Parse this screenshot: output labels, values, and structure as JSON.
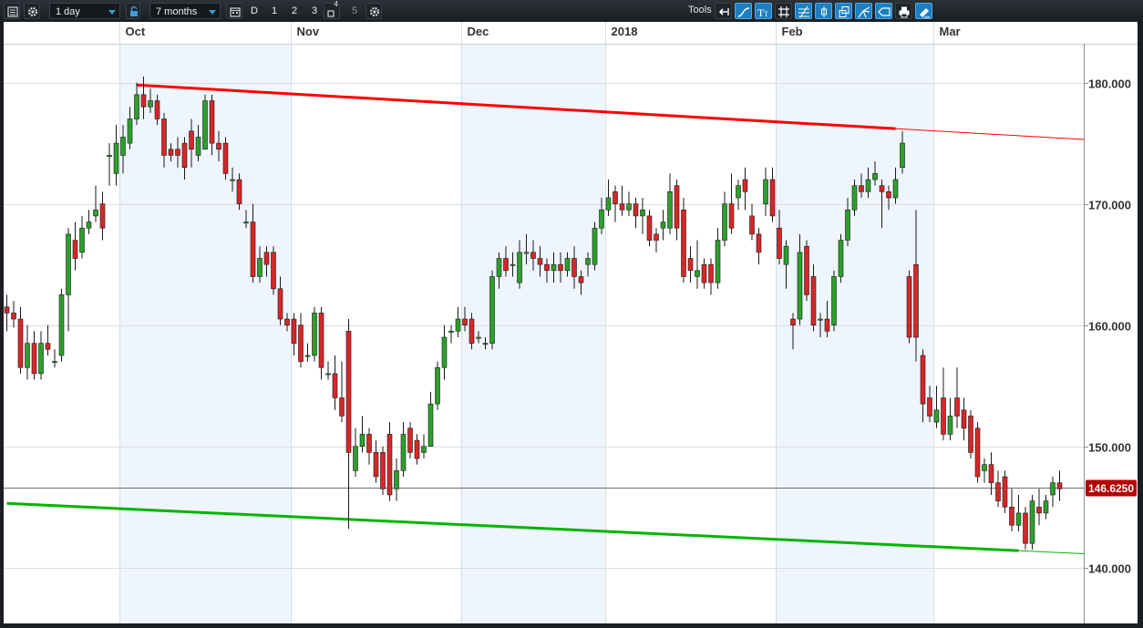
{
  "toolbar": {
    "interval": "1 day",
    "range": "7 months",
    "chart_type_buttons": [
      "D",
      "1",
      "2",
      "3",
      "4",
      "5"
    ],
    "tools_label": "Tools"
  },
  "colors": {
    "up": "#2ca02c",
    "down": "#d62728",
    "resistance_line": "#ff0000",
    "support_line": "#00b400",
    "price_badge": "#b40000",
    "shade": "#eef5fc"
  },
  "chart_data": {
    "type": "candlestick",
    "x_tick_labels": [
      "Oct",
      "Nov",
      "Dec",
      "2018",
      "Feb",
      "Mar"
    ],
    "y_tick_labels": [
      "140.000",
      "150.000",
      "160.000",
      "170.000",
      "180.000"
    ],
    "ylim": [
      135.4,
      183.2
    ],
    "last_price": "146.6250",
    "last_price_value": 146.625,
    "grid": "horizontal",
    "shaded_periods": [
      "Oct",
      "Dec",
      "Feb"
    ],
    "candles": [
      [
        161.5,
        161.0,
        162.5,
        159.5
      ],
      [
        161.0,
        160.5,
        162.0,
        159.8
      ],
      [
        160.5,
        156.5,
        161.5,
        156.0
      ],
      [
        156.5,
        158.5,
        160.0,
        155.5
      ],
      [
        158.5,
        156.0,
        159.5,
        155.5
      ],
      [
        156.0,
        158.5,
        159.5,
        155.5
      ],
      [
        158.5,
        158.0,
        160.0,
        157.5
      ],
      [
        157.0,
        157.0,
        158.0,
        156.5
      ],
      [
        157.5,
        162.5,
        163.0,
        157.0
      ],
      [
        162.5,
        167.5,
        168.0,
        159.5
      ],
      [
        167.0,
        165.5,
        168.5,
        164.5
      ],
      [
        166.0,
        168.0,
        169.0,
        165.5
      ],
      [
        168.0,
        168.5,
        169.5,
        167.5
      ],
      [
        169.0,
        169.5,
        171.5,
        168.5
      ],
      [
        170.0,
        168.0,
        171.0,
        167.0
      ],
      [
        174.0,
        174.0,
        175.0,
        171.5
      ],
      [
        172.5,
        175.0,
        176.5,
        171.5
      ],
      [
        174.0,
        175.5,
        176.5,
        172.5
      ],
      [
        175.0,
        177.0,
        178.0,
        174.5
      ],
      [
        177.0,
        179.0,
        180.0,
        176.5
      ],
      [
        179.0,
        178.0,
        180.5,
        177.0
      ],
      [
        178.0,
        178.5,
        179.5,
        177.5
      ],
      [
        178.5,
        177.0,
        179.0,
        176.5
      ],
      [
        177.0,
        174.0,
        177.5,
        173.0
      ],
      [
        174.5,
        174.0,
        175.0,
        173.5
      ],
      [
        174.5,
        174.0,
        175.5,
        173.0
      ],
      [
        175.0,
        173.0,
        175.5,
        172.0
      ],
      [
        176.0,
        174.5,
        177.0,
        173.0
      ],
      [
        174.0,
        175.5,
        176.5,
        173.5
      ],
      [
        174.5,
        178.5,
        179.0,
        174.5
      ],
      [
        178.5,
        175.0,
        179.0,
        174.0
      ],
      [
        175.0,
        174.5,
        176.0,
        173.5
      ],
      [
        175.0,
        172.5,
        175.5,
        172.0
      ],
      [
        172.0,
        172.0,
        173.0,
        171.0
      ],
      [
        172.0,
        170.0,
        172.5,
        169.5
      ],
      [
        168.5,
        168.5,
        169.5,
        168.0
      ],
      [
        168.5,
        164.0,
        170.0,
        163.5
      ],
      [
        164.0,
        165.5,
        166.5,
        163.5
      ],
      [
        166.0,
        165.0,
        166.5,
        164.0
      ],
      [
        166.0,
        163.0,
        166.5,
        162.5
      ],
      [
        163.0,
        160.5,
        164.0,
        160.0
      ],
      [
        160.5,
        160.0,
        161.0,
        159.5
      ],
      [
        160.5,
        158.5,
        161.0,
        157.5
      ],
      [
        160.0,
        157.0,
        161.0,
        156.5
      ],
      [
        157.5,
        157.5,
        158.5,
        157.0
      ],
      [
        157.5,
        161.0,
        161.5,
        157.0
      ],
      [
        161.0,
        156.5,
        161.5,
        155.5
      ],
      [
        156.0,
        156.0,
        157.0,
        155.5
      ],
      [
        156.0,
        154.0,
        157.5,
        153.0
      ],
      [
        154.0,
        152.5,
        157.0,
        152.0
      ],
      [
        159.5,
        149.5,
        160.5,
        143.2
      ],
      [
        148.0,
        150.0,
        151.5,
        147.5
      ],
      [
        150.0,
        151.0,
        152.5,
        149.5
      ],
      [
        151.0,
        149.5,
        151.5,
        148.5
      ],
      [
        149.5,
        147.5,
        150.5,
        147.0
      ],
      [
        149.5,
        146.5,
        150.0,
        146.0
      ],
      [
        151.0,
        146.0,
        152.0,
        145.5
      ],
      [
        146.5,
        148.0,
        149.0,
        145.5
      ],
      [
        148.0,
        151.0,
        152.0,
        147.5
      ],
      [
        151.5,
        149.5,
        152.0,
        149.0
      ],
      [
        150.5,
        149.0,
        151.0,
        148.5
      ],
      [
        149.5,
        150.0,
        151.0,
        149.0
      ],
      [
        150.0,
        153.5,
        154.5,
        150.0
      ],
      [
        153.5,
        156.5,
        157.0,
        153.0
      ],
      [
        156.5,
        159.0,
        160.0,
        155.5
      ],
      [
        159.5,
        159.5,
        160.0,
        158.5
      ],
      [
        159.5,
        160.5,
        161.5,
        159.0
      ],
      [
        160.5,
        160.0,
        161.5,
        159.5
      ],
      [
        160.5,
        158.5,
        161.0,
        158.0
      ],
      [
        159.0,
        159.0,
        159.5,
        158.5
      ],
      [
        158.5,
        158.5,
        159.0,
        158.0
      ],
      [
        158.5,
        164.0,
        164.5,
        158.0
      ],
      [
        164.0,
        165.5,
        166.0,
        163.0
      ],
      [
        165.5,
        164.5,
        166.5,
        164.0
      ],
      [
        165.0,
        165.0,
        166.0,
        164.0
      ],
      [
        163.5,
        166.0,
        167.0,
        163.0
      ],
      [
        166.0,
        166.0,
        167.5,
        165.0
      ],
      [
        166.0,
        165.5,
        167.0,
        164.5
      ],
      [
        165.5,
        165.0,
        166.5,
        164.0
      ],
      [
        165.0,
        164.5,
        165.5,
        163.5
      ],
      [
        164.5,
        165.0,
        166.0,
        163.5
      ],
      [
        165.0,
        164.5,
        166.0,
        163.5
      ],
      [
        164.5,
        165.5,
        166.0,
        164.0
      ],
      [
        165.5,
        164.0,
        166.5,
        163.0
      ],
      [
        164.0,
        163.5,
        164.5,
        162.5
      ],
      [
        165.0,
        165.5,
        166.0,
        164.0
      ],
      [
        165.0,
        168.0,
        168.5,
        164.5
      ],
      [
        168.0,
        169.5,
        170.5,
        167.5
      ],
      [
        169.5,
        170.5,
        172.0,
        169.0
      ],
      [
        171.0,
        170.0,
        171.5,
        168.5
      ],
      [
        170.0,
        169.5,
        171.5,
        169.0
      ],
      [
        169.5,
        170.0,
        171.0,
        169.0
      ],
      [
        170.0,
        169.0,
        170.5,
        168.0
      ],
      [
        169.0,
        169.5,
        170.5,
        167.5
      ],
      [
        169.0,
        167.0,
        169.5,
        166.5
      ],
      [
        167.5,
        167.0,
        168.0,
        166.0
      ],
      [
        168.0,
        168.5,
        169.5,
        167.0
      ],
      [
        168.0,
        171.0,
        172.5,
        167.5
      ],
      [
        171.5,
        168.0,
        172.0,
        167.0
      ],
      [
        169.5,
        164.0,
        170.5,
        163.5
      ],
      [
        165.5,
        164.5,
        166.5,
        163.5
      ],
      [
        164.0,
        164.5,
        167.0,
        163.0
      ],
      [
        165.0,
        163.5,
        165.5,
        163.0
      ],
      [
        165.0,
        163.5,
        165.5,
        162.5
      ],
      [
        163.5,
        167.0,
        168.0,
        163.0
      ],
      [
        167.0,
        170.0,
        171.0,
        166.5
      ],
      [
        170.0,
        168.0,
        172.5,
        167.5
      ],
      [
        170.5,
        171.5,
        172.0,
        169.5
      ],
      [
        172.0,
        171.0,
        173.0,
        169.5
      ],
      [
        169.0,
        167.5,
        170.0,
        167.0
      ],
      [
        167.5,
        166.0,
        168.0,
        165.0
      ],
      [
        170.0,
        172.0,
        173.0,
        169.0
      ],
      [
        172.0,
        169.0,
        173.0,
        168.5
      ],
      [
        168.0,
        165.5,
        169.5,
        165.0
      ],
      [
        165.0,
        166.5,
        167.0,
        163.0
      ],
      [
        160.5,
        160.0,
        161.0,
        158.0
      ],
      [
        160.5,
        166.0,
        167.5,
        160.0
      ],
      [
        166.5,
        162.5,
        167.0,
        162.0
      ],
      [
        164.0,
        160.0,
        165.0,
        159.5
      ],
      [
        160.5,
        160.5,
        161.0,
        159.0
      ],
      [
        160.5,
        159.5,
        162.0,
        159.0
      ],
      [
        160.0,
        164.0,
        164.5,
        159.5
      ],
      [
        164.0,
        167.0,
        167.5,
        163.5
      ],
      [
        167.0,
        169.5,
        170.5,
        166.5
      ],
      [
        169.5,
        171.5,
        172.0,
        169.0
      ],
      [
        171.5,
        171.0,
        172.5,
        170.5
      ],
      [
        171.0,
        172.0,
        173.0,
        170.5
      ],
      [
        172.0,
        172.5,
        173.5,
        171.5
      ],
      [
        171.5,
        171.0,
        172.0,
        168.0
      ],
      [
        171.0,
        170.5,
        171.5,
        169.5
      ],
      [
        170.5,
        172.0,
        173.0,
        170.0
      ],
      [
        173.0,
        175.0,
        176.0,
        172.5
      ],
      [
        164.0,
        159.0,
        164.5,
        158.5
      ],
      [
        165.0,
        159.0,
        169.5,
        157.0
      ],
      [
        157.5,
        153.5,
        158.0,
        152.0
      ],
      [
        154.0,
        152.5,
        155.0,
        152.0
      ],
      [
        152.0,
        153.0,
        155.0,
        151.5
      ],
      [
        154.0,
        151.0,
        156.5,
        150.5
      ],
      [
        151.0,
        152.5,
        154.0,
        150.5
      ],
      [
        154.0,
        152.5,
        156.5,
        151.5
      ],
      [
        153.0,
        151.5,
        154.0,
        150.5
      ],
      [
        152.5,
        149.5,
        153.0,
        149.0
      ],
      [
        151.5,
        147.5,
        152.0,
        147.0
      ],
      [
        148.0,
        148.5,
        149.0,
        147.0
      ],
      [
        148.5,
        147.0,
        149.5,
        146.0
      ],
      [
        147.0,
        145.5,
        148.0,
        145.0
      ],
      [
        147.5,
        145.0,
        148.0,
        144.5
      ],
      [
        145.0,
        143.5,
        146.5,
        143.0
      ],
      [
        143.5,
        144.5,
        146.0,
        143.0
      ],
      [
        144.5,
        142.0,
        145.0,
        141.5
      ],
      [
        142.0,
        145.5,
        146.0,
        141.5
      ],
      [
        145.0,
        144.5,
        146.5,
        143.5
      ],
      [
        144.5,
        145.5,
        146.0,
        144.0
      ],
      [
        146.0,
        147.0,
        147.5,
        145.0
      ],
      [
        147.0,
        146.5,
        148.0,
        145.5
      ]
    ],
    "trendlines": [
      {
        "name": "resistance",
        "points": [
          [
            19,
            179.8
          ],
          [
            130,
            176.2
          ]
        ],
        "extends_to_end": true
      },
      {
        "name": "support",
        "points": [
          [
            0,
            145.3
          ],
          [
            148,
            141.4
          ]
        ],
        "extends_to_end": true
      }
    ]
  }
}
